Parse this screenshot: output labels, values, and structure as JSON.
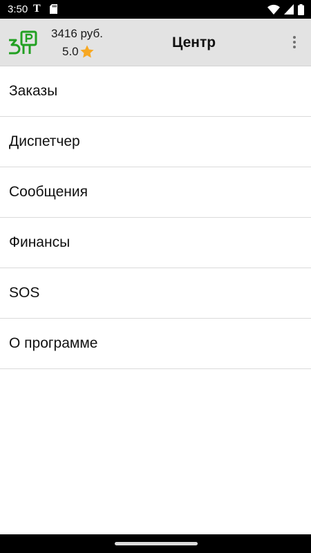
{
  "status_bar": {
    "time": "3:50",
    "notification_letter": "T",
    "icons": [
      "sd-card-icon",
      "wifi-icon",
      "cellular-signal-icon",
      "battery-icon"
    ]
  },
  "app_bar": {
    "balance": "3416 руб.",
    "rating": "5.0",
    "title": "Центр",
    "logo_icon": "parking-logo-icon",
    "rating_icon": "star-icon",
    "menu_icon": "more-vert-icon",
    "colors": {
      "logo_green": "#22a022",
      "star": "#f7a823",
      "app_bar_bg": "#e3e3e3"
    }
  },
  "menu": {
    "items": [
      {
        "label": "Заказы"
      },
      {
        "label": "Диспетчер"
      },
      {
        "label": "Сообщения"
      },
      {
        "label": "Финансы"
      },
      {
        "label": "SOS"
      },
      {
        "label": "О программе"
      }
    ]
  }
}
